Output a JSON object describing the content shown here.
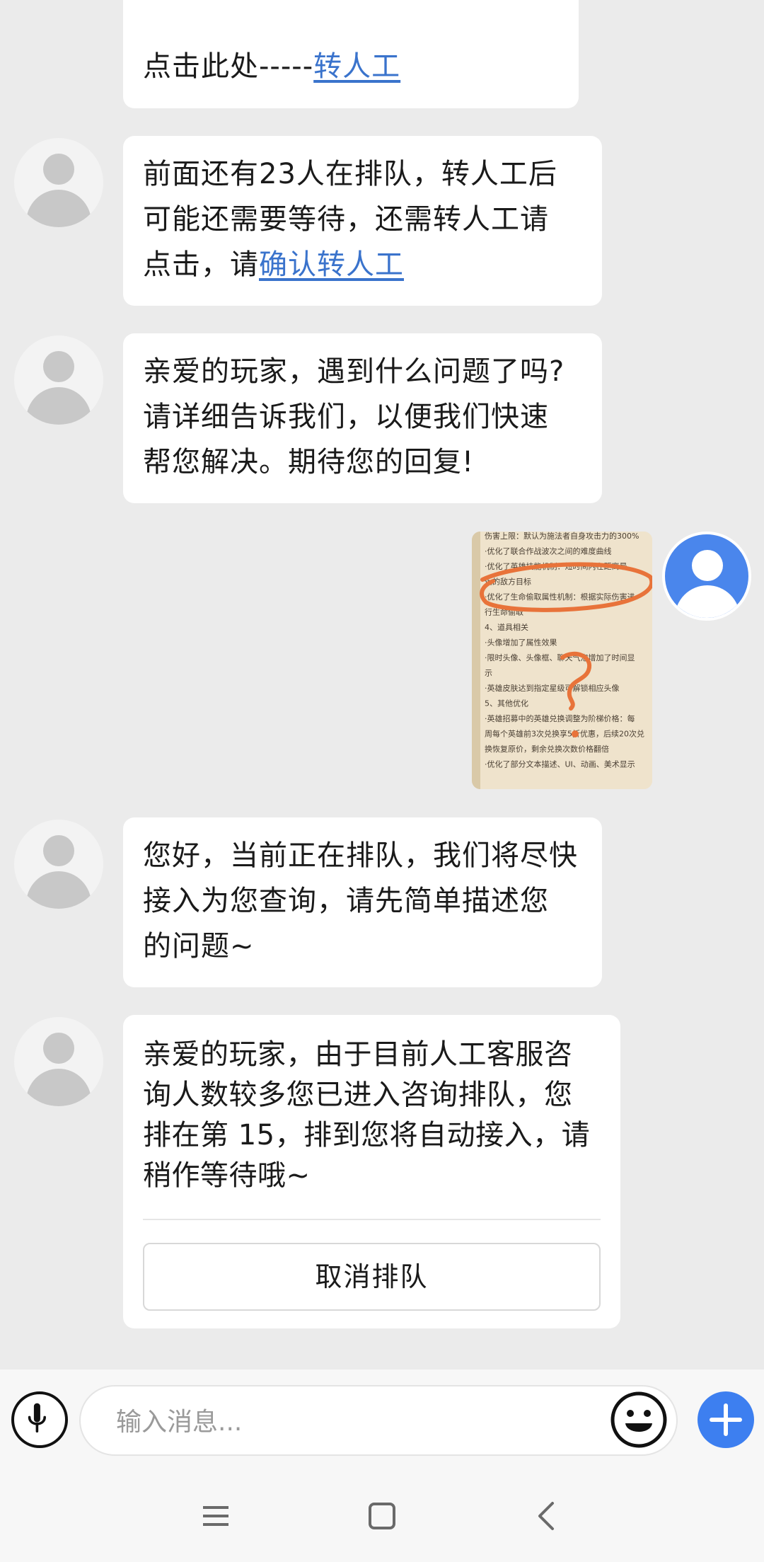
{
  "messages": {
    "m0": {
      "prefix": "点击此处-----",
      "link": "转人工"
    },
    "m1": {
      "line1": "前面还有23人在排队，转人工后",
      "line2": "可能还需要等待，还需转人工请",
      "line3_prefix": "点击，请",
      "line3_link": "确认转人工"
    },
    "m2": {
      "line1": "亲爱的玩家，遇到什么问题了吗?",
      "line2": "请详细告诉我们，以便我们快速",
      "line3": "帮您解决。期待您的回复!"
    },
    "m3": {
      "attachment_lines": [
        "伤害上限：默认为施法者自身攻击力的300%",
        "·优化了联合作战波次之间的难度曲线",
        "·优化了英雄技能机制：短时间内在距离最",
        "近的敌方目标",
        "·优化了生命偷取属性机制：根据实际伤害进",
        "行生命偷取",
        "4、道具相关",
        "·头像增加了属性效果",
        "·限时头像、头像框、聊天气泡增加了时间显",
        "示",
        "·英雄皮肤达到指定星级可解锁相应头像",
        "5、其他优化",
        "·英雄招募中的英雄兑换调整为阶梯价格：每",
        "周每个英雄前3次兑换享5折优惠，后续20次兑",
        "换恢复原价，剩余兑换次数价格翻倍",
        "·优化了部分文本描述、UI、动画、美术显示"
      ]
    },
    "m4": {
      "line1": "您好，当前正在排队，我们将尽快",
      "line2": "接入为您查询，请先简单描述您",
      "line3": "的问题~"
    },
    "m5": {
      "line1": "亲爱的玩家，由于目前人工客服咨",
      "line2": "询人数较多您已进入咨询排队，您",
      "line3": "排在第 15，排到您将自动接入，请",
      "line4": "稍作等待哦~",
      "button": "取消排队"
    }
  },
  "input": {
    "placeholder": "输入消息..."
  },
  "colors": {
    "link": "#3a73cc",
    "accent": "#3d7ff0",
    "chat_bg": "#ebebeb",
    "bubble_bg": "#ffffff",
    "annotation": "#e8733a"
  },
  "icons": {
    "mic": "microphone-icon",
    "emoji": "smiley-icon",
    "plus": "plus-icon",
    "menu": "menu-icon",
    "home": "home-square-icon",
    "back": "back-chevron-icon"
  }
}
